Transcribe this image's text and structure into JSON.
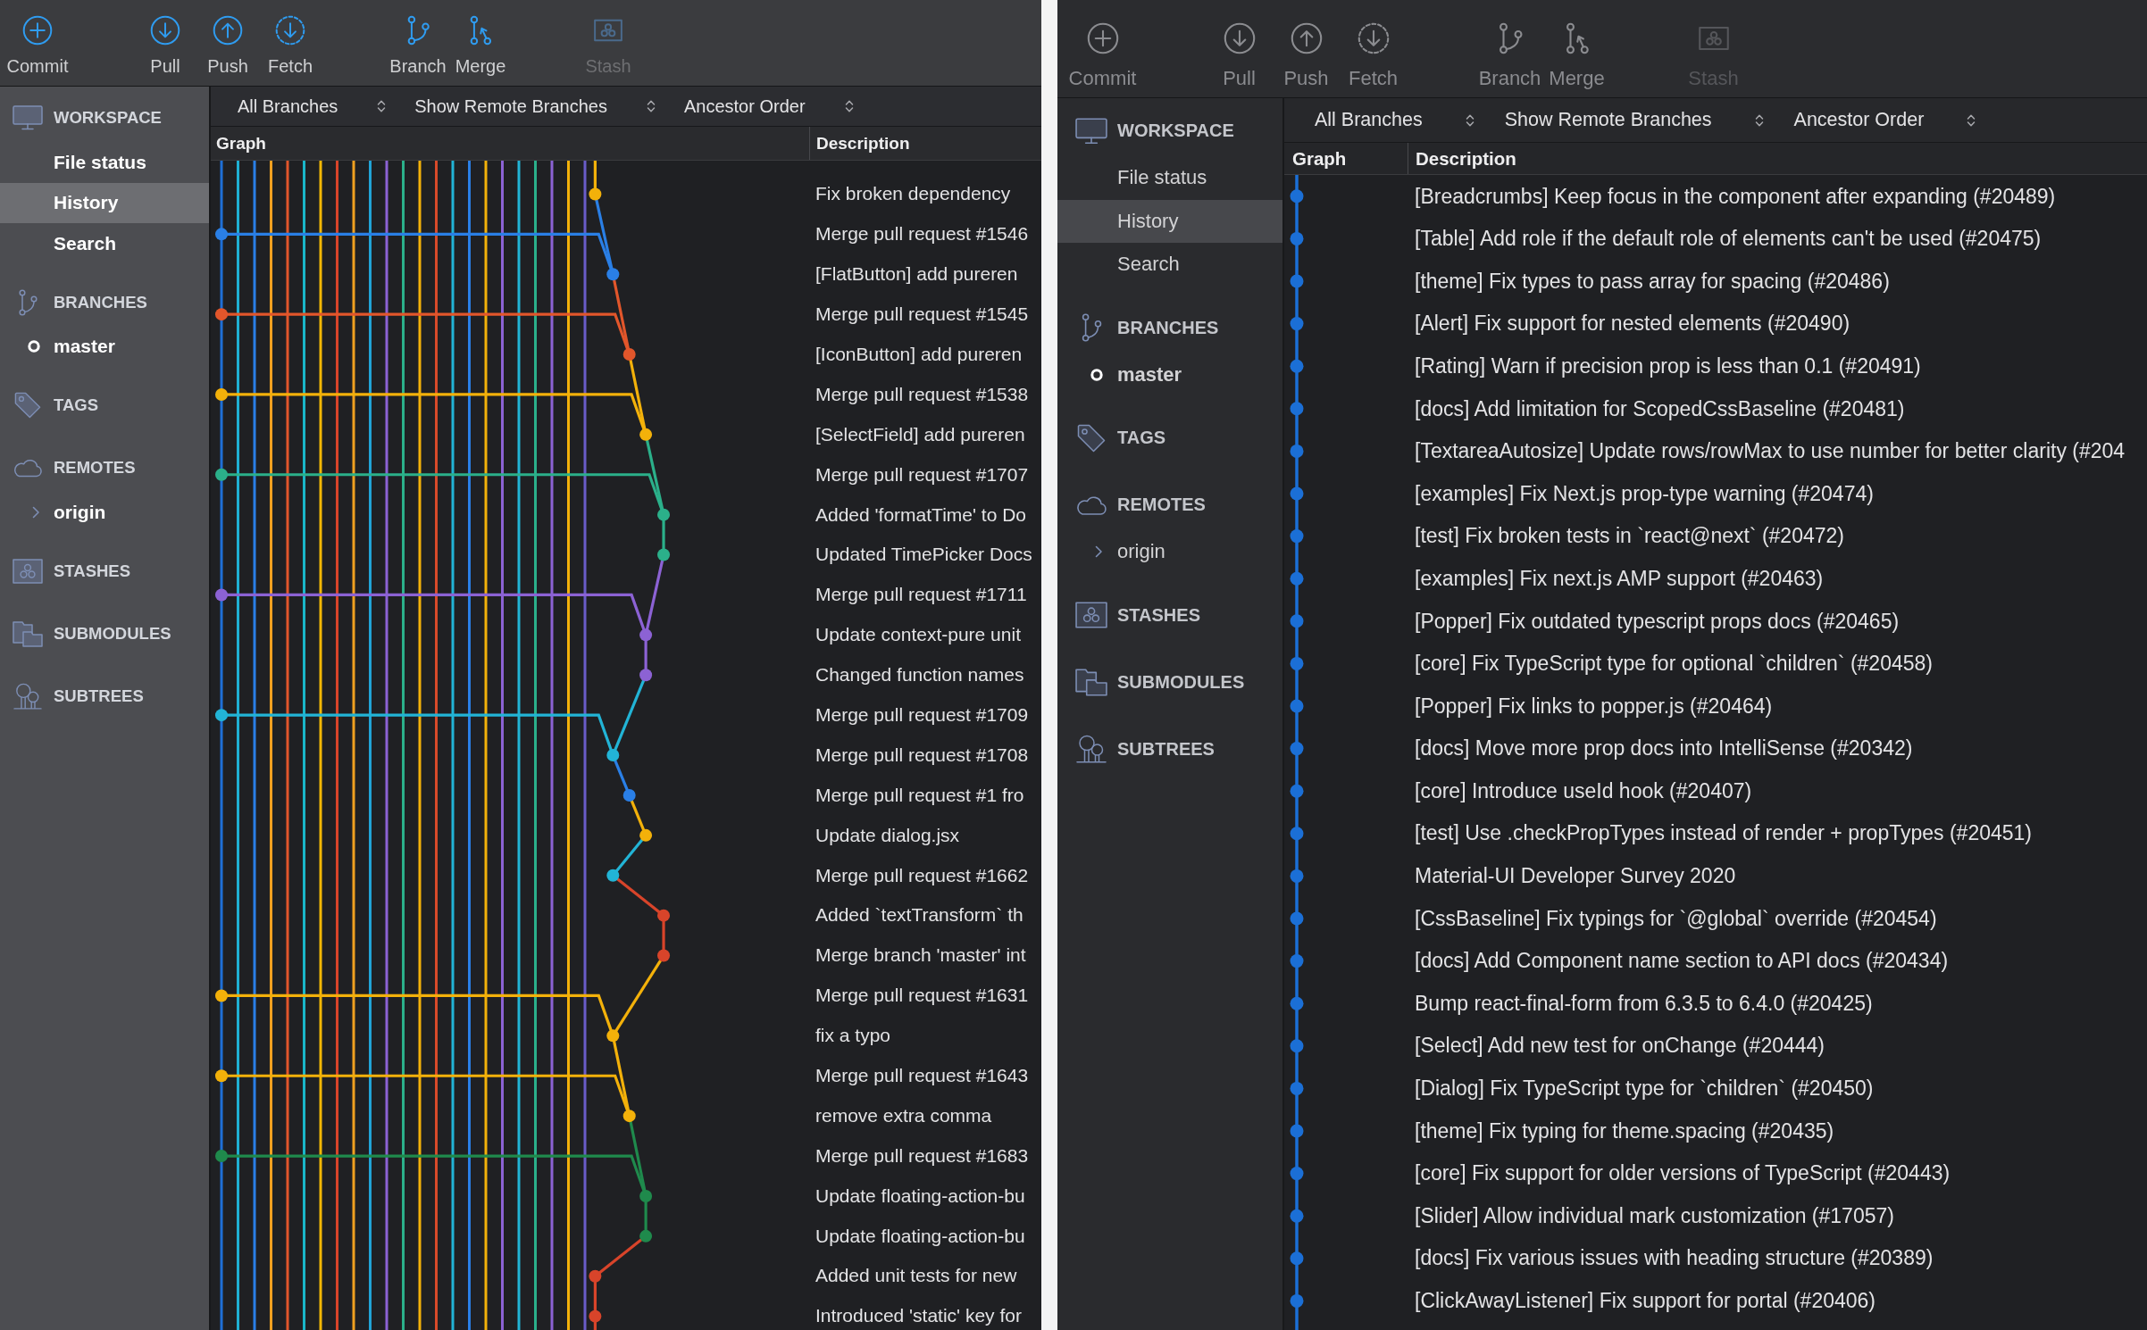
{
  "windows": [
    {
      "active": true,
      "toolbar": [
        {
          "label": "Commit",
          "disabled": false
        },
        {
          "label": "Pull",
          "disabled": false
        },
        {
          "label": "Push",
          "disabled": false
        },
        {
          "label": "Fetch",
          "disabled": false
        },
        {
          "label": "Branch",
          "disabled": false
        },
        {
          "label": "Merge",
          "disabled": false
        },
        {
          "label": "Stash",
          "disabled": true
        }
      ],
      "sidebar": [
        {
          "heading": "WORKSPACE",
          "items": [
            {
              "label": "File status",
              "selected": false
            },
            {
              "label": "History",
              "selected": true
            },
            {
              "label": "Search",
              "selected": false
            }
          ]
        },
        {
          "heading": "BRANCHES",
          "items": [
            {
              "label": "master",
              "selected": false,
              "current": true
            }
          ]
        },
        {
          "heading": "TAGS"
        },
        {
          "heading": "REMOTES",
          "items": [
            {
              "label": "origin",
              "selected": false,
              "expanded": false
            }
          ]
        },
        {
          "heading": "STASHES"
        },
        {
          "heading": "SUBMODULES"
        },
        {
          "heading": "SUBTREES"
        }
      ],
      "filters": [
        "All Branches",
        "Show Remote Branches",
        "Ancestor Order"
      ],
      "columns": [
        "Graph",
        "Description"
      ],
      "commits": [
        "Fix broken dependency",
        "Merge pull request #1546",
        "[FlatButton] add pureren",
        "Merge pull request #1545",
        "[IconButton] add pureren",
        "Merge pull request #1538",
        "[SelectField] add pureren",
        "Merge pull request #1707",
        "Added 'formatTime' to Do",
        "Updated TimePicker Docs",
        "Merge pull request #1711",
        "Update context-pure unit",
        "Changed function names",
        "Merge pull request #1709",
        "Merge pull request #1708",
        "Merge pull request #1 fro",
        "Update dialog.jsx",
        "Merge pull request #1662",
        "Added `textTransform` th",
        "Merge branch 'master' int",
        "Merge pull request #1631",
        "fix a typo",
        "Merge pull request #1643",
        "remove extra comma",
        "Merge pull request #1683",
        "Update floating-action-bu",
        "Update floating-action-bu",
        "Added unit tests for new",
        "Introduced 'static' key for"
      ]
    },
    {
      "active": false,
      "toolbar": [
        {
          "label": "Commit",
          "disabled": false
        },
        {
          "label": "Pull",
          "disabled": false
        },
        {
          "label": "Push",
          "disabled": false
        },
        {
          "label": "Fetch",
          "disabled": false
        },
        {
          "label": "Branch",
          "disabled": false
        },
        {
          "label": "Merge",
          "disabled": false
        },
        {
          "label": "Stash",
          "disabled": true
        }
      ],
      "sidebar": [
        {
          "heading": "WORKSPACE",
          "items": [
            {
              "label": "File status",
              "selected": false
            },
            {
              "label": "History",
              "selected": true
            },
            {
              "label": "Search",
              "selected": false
            }
          ]
        },
        {
          "heading": "BRANCHES",
          "items": [
            {
              "label": "master",
              "selected": false,
              "current": true
            }
          ]
        },
        {
          "heading": "TAGS"
        },
        {
          "heading": "REMOTES",
          "items": [
            {
              "label": "origin",
              "selected": false,
              "expanded": false
            }
          ]
        },
        {
          "heading": "STASHES"
        },
        {
          "heading": "SUBMODULES"
        },
        {
          "heading": "SUBTREES"
        }
      ],
      "filters": [
        "All Branches",
        "Show Remote Branches",
        "Ancestor Order"
      ],
      "columns": [
        "Graph",
        "Description"
      ],
      "commits": [
        "[Breadcrumbs] Keep focus in the component after expanding (#20489)",
        "[Table] Add role if the default role of elements can't be used (#20475)",
        "[theme] Fix types to pass array for spacing (#20486)",
        "[Alert] Fix support for nested elements (#20490)",
        "[Rating] Warn if precision prop is less than 0.1 (#20491)",
        "[docs] Add limitation for ScopedCssBaseline (#20481)",
        "[TextareaAutosize] Update rows/rowMax to use number for better clarity (#204",
        "[examples] Fix Next.js prop-type warning (#20474)",
        "[test] Fix broken tests in `react@next` (#20472)",
        "[examples] Fix next.js AMP support (#20463)",
        "[Popper] Fix outdated typescript props docs (#20465)",
        "[core] Fix TypeScript type for optional `children` (#20458)",
        "[Popper] Fix links to popper.js (#20464)",
        "[docs] Move more prop docs into IntelliSense (#20342)",
        "[core] Introduce useId hook (#20407)",
        "[test] Use .checkPropTypes instead of render + propTypes (#20451)",
        "Material-UI Developer Survey 2020",
        "[CssBaseline] Fix typings for `@global` override (#20454)",
        "[docs] Add Component name section to API docs (#20434)",
        "Bump react-final-form from 6.3.5 to 6.4.0 (#20425)",
        "[Select] Add new test for onChange (#20444)",
        "[Dialog] Fix TypeScript type for `children` (#20450)",
        "[theme] Fix typing for theme.spacing (#20435)",
        "[core] Fix support for older versions of TypeScript (#20443)",
        "[Slider] Allow individual mark customization (#17057)",
        "[docs] Fix various issues with heading structure (#20389)",
        "[ClickAwayListener] Fix support for portal (#20406)"
      ]
    }
  ]
}
